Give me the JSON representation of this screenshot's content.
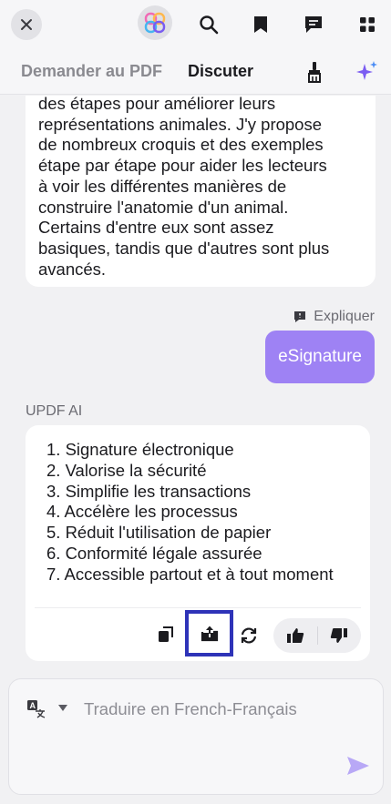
{
  "header": {
    "icons": [
      "close-icon",
      "updf-logo-icon",
      "search-icon",
      "bookmark-icon",
      "comment-icon",
      "grid-icon"
    ]
  },
  "tabs": {
    "ask_pdf": "Demander au PDF",
    "chat": "Discuter",
    "active": "chat",
    "icons": [
      "brush-icon",
      "sparkle-icon"
    ]
  },
  "conversation": {
    "previous_answer_lines": [
      "des étapes pour améliorer leurs",
      "représentations animales. J'y propose",
      "de nombreux croquis et des exemples",
      "étape par étape pour aider les lecteurs",
      "à voir les différentes manières de",
      "construire l'anatomie d'un animal.",
      "Certains d'entre eux sont assez",
      "basiques, tandis que d'autres sont plus",
      "avancés."
    ],
    "explain_label": "Expliquer",
    "user_message": "eSignature",
    "ai_label": "UPDF AI",
    "ai_answer": [
      "1. Signature électronique",
      "2. Valorise la sécurité",
      "3. Simplifie les transactions",
      "4. Accélère les processus",
      "5. Réduit l'utilisation de papier",
      "6. Conformité légale assurée",
      "7. Accessible partout et à tout moment"
    ],
    "action_icons": [
      "copy-icon",
      "export-icon",
      "refresh-icon",
      "thumbs-up-icon",
      "thumbs-down-icon"
    ]
  },
  "composer": {
    "placeholder": "Traduire en French-Français",
    "value": "",
    "icons": [
      "translate-icon",
      "caret-down-icon",
      "send-icon"
    ]
  },
  "colors": {
    "accent": "#9e82f4",
    "highlight_border": "#2e33b8",
    "background": "#f1f1f3"
  }
}
